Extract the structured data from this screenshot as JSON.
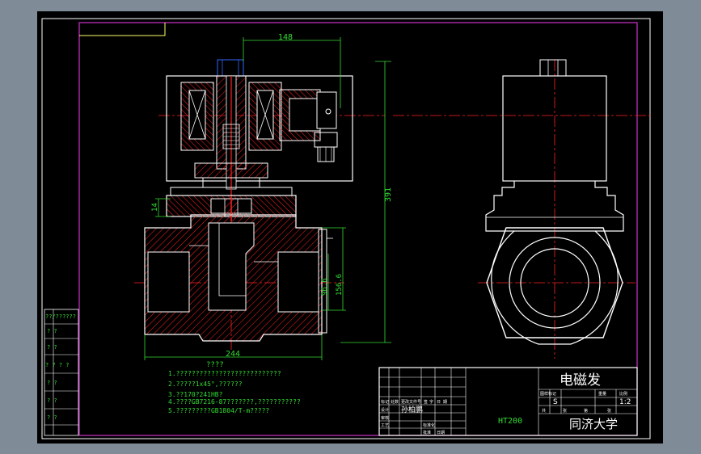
{
  "colors": {
    "background_outer": "#7f8c97",
    "paper": "#000000",
    "outline": "#ffffff",
    "dimension": "#33dd33",
    "centerline": "#ff2222",
    "hatch": "#ff2222",
    "border": "#cc33cc",
    "blue_part": "#3366ff"
  },
  "dimensions": {
    "width_top": "148",
    "height_total": "391",
    "flange_thickness": "14",
    "pipe_center_a": "96.6",
    "pipe_center_b": "156.6",
    "width_bottom": "244"
  },
  "tech_requirements": {
    "heading": "????",
    "lines": [
      "1.???????????????????????????",
      "2.?????1x45°,??????",
      "3.??170?241HB?",
      "4.????GB7216-87???????,???????????",
      "5.?????????GB1804/T-m?????"
    ]
  },
  "left_strip": {
    "labels": [
      "??/??????",
      "?  ?",
      "?  ?",
      "? ? ? ?",
      "?  ?",
      "?  ?",
      "?  ?"
    ]
  },
  "title_block": {
    "part_name": "电磁发",
    "scale": "1:2",
    "material": "HT200",
    "university": "同济大学",
    "designer_name": "孙柏鹏",
    "sheet_label": "S",
    "header_labels": [
      "标记",
      "处数",
      "更改文件号",
      "签",
      "字",
      "日",
      "期"
    ],
    "row_labels": [
      "设计",
      "审核",
      "工艺",
      "标准化",
      "批准",
      "日期"
    ],
    "right_header": [
      "图样标记",
      "重量",
      "比例"
    ],
    "sheet_row": [
      "共",
      "张",
      "第",
      "张"
    ]
  }
}
